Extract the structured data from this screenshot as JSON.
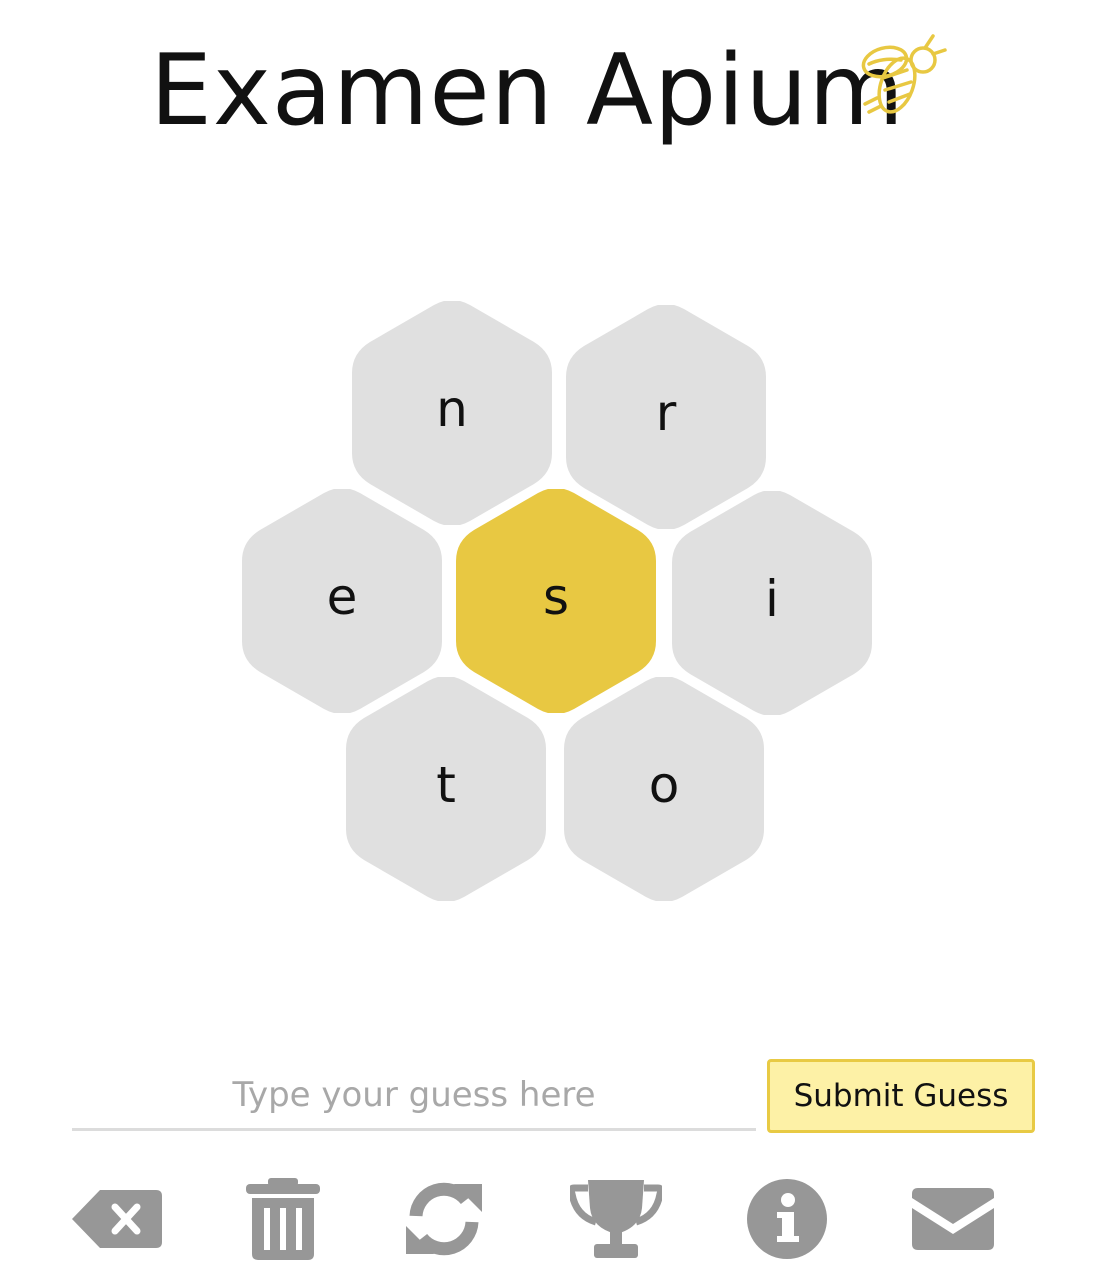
{
  "game": {
    "title": "Examen Apium",
    "center_letter": "s",
    "outer_letters": {
      "top_left": "n",
      "top_right": "r",
      "left": "e",
      "right": "i",
      "bottom_left": "t",
      "bottom_right": "o"
    }
  },
  "guess": {
    "placeholder": "Type your guess here",
    "value": "",
    "submit_label": "Submit Guess"
  },
  "toolbar": {
    "icons": [
      "backspace-icon",
      "trash-icon",
      "refresh-icon",
      "trophy-icon",
      "info-icon",
      "mail-icon"
    ]
  },
  "colors": {
    "center_hex": "#e8c842",
    "outer_hex": "#e0e0e0",
    "accent": "#e8ca44",
    "submit_bg": "#fdf1a6",
    "icon_gray": "#979797"
  }
}
